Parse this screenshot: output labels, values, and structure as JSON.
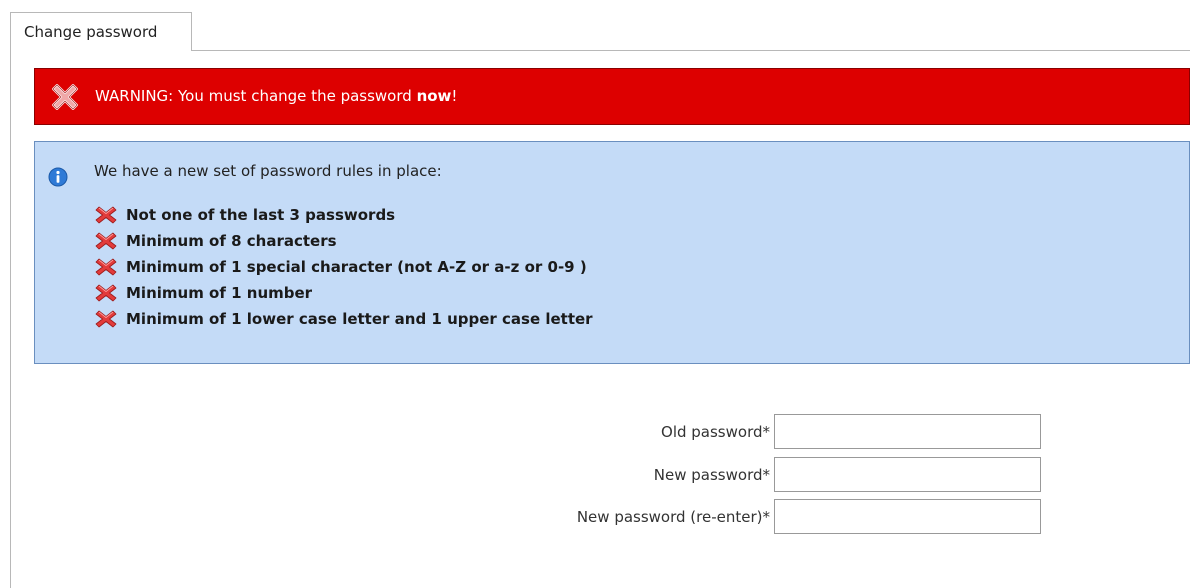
{
  "tab": {
    "label": "Change password"
  },
  "warning": {
    "prefix": "WARNING: You must change the password ",
    "emphasis": "now",
    "suffix": "!",
    "icon": "error-x-icon",
    "color": "#dd0000"
  },
  "info": {
    "intro": "We have a new set of password rules in place:",
    "icon": "info-icon",
    "color": "#c4dbf7",
    "rules": [
      {
        "label": "Not one of the last 3 passwords",
        "status": "unmet"
      },
      {
        "label": "Minimum of 8 characters",
        "status": "unmet"
      },
      {
        "label": "Minimum of 1 special character (not A-Z or a-z or 0-9 )",
        "status": "unmet"
      },
      {
        "label": "Minimum of 1 number",
        "status": "unmet"
      },
      {
        "label": "Minimum of 1 lower case letter and 1 upper case letter",
        "status": "unmet"
      }
    ]
  },
  "form": {
    "old_password": {
      "label": "Old password*",
      "value": ""
    },
    "new_password": {
      "label": "New password*",
      "value": ""
    },
    "confirm_password": {
      "label": "New password (re-enter)*",
      "value": ""
    }
  }
}
